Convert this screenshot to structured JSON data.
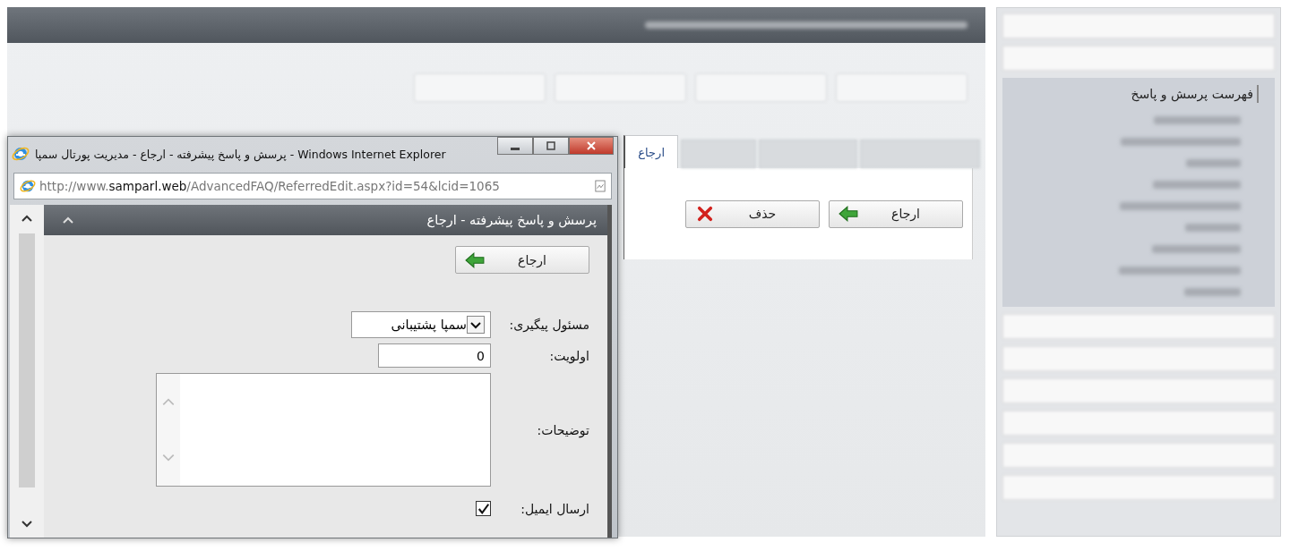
{
  "background_page": {
    "tabs": [
      {
        "label": "ارجاع",
        "selected": true
      }
    ],
    "buttons": [
      {
        "label": "ارجاع",
        "kind": "refer"
      },
      {
        "label": "حذف",
        "kind": "delete"
      }
    ],
    "sidebar": {
      "items": [
        {
          "label": "فهرست پرسش و پاسخ",
          "selected": true
        }
      ]
    }
  },
  "popup": {
    "title": "پرسش و پاسخ پیشرفته - ارجاع - مدیریت پورتال سمپا - Windows Internet Explorer",
    "address": "http://www.**samparl.web**/AdvancedFAQ/ReferredEdit.aspx?id=54&lcid=1065",
    "panel": {
      "title": "پرسش و پاسخ پیشرفته - ارجاع",
      "button": {
        "label": "ارجاع",
        "kind": "refer"
      },
      "fields": [
        {
          "kind": "select",
          "label": "مسئول پیگیری:",
          "value": "سمپا پشتیبانی"
        },
        {
          "kind": "text",
          "label": "اولویت:",
          "value": "0"
        },
        {
          "kind": "textarea",
          "label": "توضیحات:"
        },
        {
          "kind": "checkbox",
          "label": "ارسال ایمیل:",
          "checked": true
        }
      ]
    }
  }
}
